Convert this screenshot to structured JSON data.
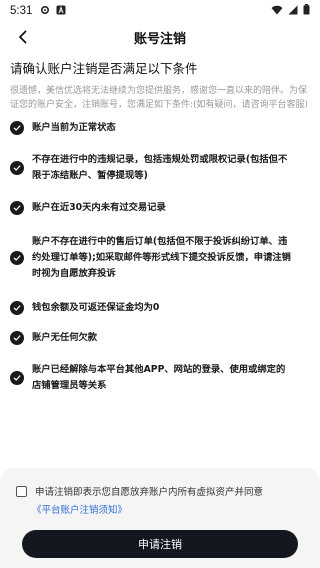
{
  "status_bar": {
    "time": "5:31",
    "icons": [
      "settings-gear-icon",
      "font-a-icon",
      "wifi-icon",
      "signal-icon",
      "battery-icon"
    ]
  },
  "nav": {
    "back_icon": "back-arrow-icon",
    "title": "账号注销"
  },
  "main": {
    "heading": "请确认账户注销是否满足以下条件",
    "description": "很遗憾，美信优选将无法继续为您提供服务，感谢您一直以来的陪伴。为保证您的账户安全，注销账号，您满足如下条件:(如有疑问，请咨询平台客服)",
    "conditions": [
      {
        "lines": [
          "账户当前为正常状态"
        ]
      },
      {
        "lines": [
          "不存在进行中的违规记录，包括违规处罚或限权记录(包括但不",
          "限于冻结账户、暂停提现等)"
        ]
      },
      {
        "lines": [
          "账户在近30天内未有过交易记录"
        ]
      },
      {
        "lines": [
          "账户不存在进行中的售后订单(包括但不限于投诉纠纷订单、违",
          "约处理订单等);如采取邮件等形式线下提交投诉反馈，申请注销",
          "时视为自愿放弃投诉"
        ]
      },
      {
        "lines": [
          "钱包余额及可返还保证金均为0"
        ]
      },
      {
        "lines": [
          "账户无任何欠款"
        ]
      },
      {
        "lines": [
          "账户已经解除与本平台其他APP、网站的登录、使用或绑定的",
          "店铺管理员等关系"
        ]
      }
    ]
  },
  "footer": {
    "agree_text": "申请注销即表示您自愿放弃账户内所有虚拟资产并同意",
    "notice_link": "《平台账户注销须知》",
    "submit_label": "申请注销",
    "checkbox_checked": false
  },
  "colors": {
    "primary_button": "#141720",
    "link": "#2f6fd8",
    "muted_text": "#999999",
    "sheet_background": "#f5f5f5"
  }
}
